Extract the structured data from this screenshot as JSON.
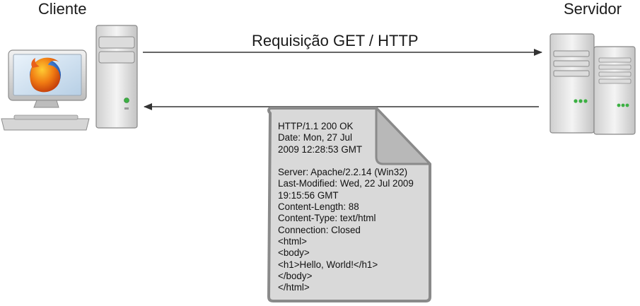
{
  "client": {
    "label": "Cliente"
  },
  "server": {
    "label": "Servidor"
  },
  "request": {
    "label": "Requisição GET / HTTP"
  },
  "response": {
    "status_lines": [
      "HTTP/1.1 200 OK",
      "Date: Mon, 27 Jul",
      "2009 12:28:53 GMT"
    ],
    "header_lines": [
      "Server: Apache/2.2.14 (Win32)",
      "Last-Modified: Wed, 22 Jul 2009",
      "19:15:56 GMT",
      "Content-Length: 88",
      "Content-Type: text/html",
      "Connection: Closed"
    ],
    "body_lines": [
      "<html>",
      "<body>",
      "<h1>Hello, World!</h1>",
      "</body>",
      "</html>"
    ]
  },
  "icons": {
    "client_monitor": "monitor-icon",
    "browser_logo": "firefox-logo-icon",
    "client_tower": "pc-tower-icon",
    "server": "server-rack-icon",
    "document": "document-icon"
  },
  "colors": {
    "arrow": "#333333",
    "document_fill": "#d9d9d9",
    "document_border": "#8a8a8a",
    "status_light": "#3cb043"
  }
}
